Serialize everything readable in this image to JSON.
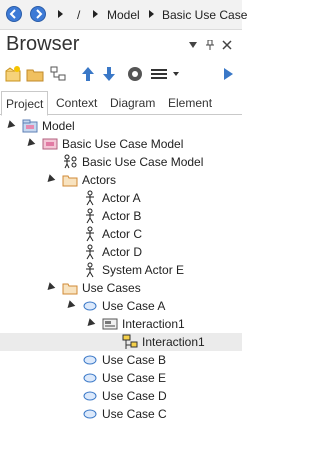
{
  "nav": {
    "back": "back-icon",
    "forward": "forward-icon",
    "crumbs": [
      "/",
      "Model",
      "Basic Use Case"
    ]
  },
  "browser": {
    "title": "Browser"
  },
  "tabs": [
    "Project",
    "Context",
    "Diagram",
    "Element"
  ],
  "tree": [
    {
      "label": "Model",
      "icon": "model-icon"
    },
    {
      "label": "Basic Use Case Model",
      "icon": "package-diagram-icon"
    },
    {
      "label": "Basic Use Case Model",
      "icon": "usecase-diagram-icon"
    },
    {
      "label": "Actors",
      "icon": "folder-icon"
    },
    {
      "label": "Actor A",
      "icon": "actor-icon"
    },
    {
      "label": "Actor B",
      "icon": "actor-icon"
    },
    {
      "label": "Actor C",
      "icon": "actor-icon"
    },
    {
      "label": "Actor D",
      "icon": "actor-icon"
    },
    {
      "label": "System Actor E",
      "icon": "actor-icon"
    },
    {
      "label": "Use Cases",
      "icon": "folder-icon"
    },
    {
      "label": "Use Case A",
      "icon": "usecase-icon"
    },
    {
      "label": "Interaction1",
      "icon": "interaction-icon"
    },
    {
      "label": "Interaction1",
      "icon": "interaction-diagram-icon"
    },
    {
      "label": "Use Case B",
      "icon": "usecase-icon"
    },
    {
      "label": "Use Case E",
      "icon": "usecase-icon"
    },
    {
      "label": "Use Case D",
      "icon": "usecase-icon"
    },
    {
      "label": "Use Case C",
      "icon": "usecase-icon"
    }
  ],
  "colors": {
    "accent": "#3d7ad6",
    "folder": "#e8a24a",
    "usecase": "#3a78c7",
    "selected_row": "#ebebeb"
  }
}
